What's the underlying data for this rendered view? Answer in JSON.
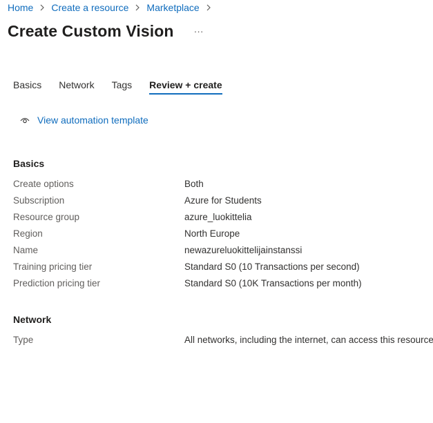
{
  "breadcrumb": {
    "items": [
      {
        "label": "Home"
      },
      {
        "label": "Create a resource"
      },
      {
        "label": "Marketplace"
      }
    ]
  },
  "header": {
    "title": "Create Custom Vision",
    "more_label": "···"
  },
  "tabs": [
    {
      "label": "Basics",
      "active": false
    },
    {
      "label": "Network",
      "active": false
    },
    {
      "label": "Tags",
      "active": false
    },
    {
      "label": "Review + create",
      "active": true
    }
  ],
  "automation": {
    "icon": "eye-icon",
    "label": "View automation template"
  },
  "sections": {
    "basics": {
      "title": "Basics",
      "rows": [
        {
          "label": "Create options",
          "value": "Both"
        },
        {
          "label": "Subscription",
          "value": "Azure for Students"
        },
        {
          "label": "Resource group",
          "value": "azure_luokittelia"
        },
        {
          "label": "Region",
          "value": "North Europe"
        },
        {
          "label": "Name",
          "value": "newazureluokittelijainstanssi"
        },
        {
          "label": "Training pricing tier",
          "value": "Standard S0 (10 Transactions per second)"
        },
        {
          "label": "Prediction pricing tier",
          "value": "Standard S0 (10K Transactions per month)"
        }
      ]
    },
    "network": {
      "title": "Network",
      "rows": [
        {
          "label": "Type",
          "value": "All networks, including the internet, can access this resource."
        }
      ]
    }
  },
  "colors": {
    "link": "#0f6cbd",
    "tab_underline": "#0f6cbd",
    "label_text": "#605e5c",
    "value_text": "#323130"
  }
}
